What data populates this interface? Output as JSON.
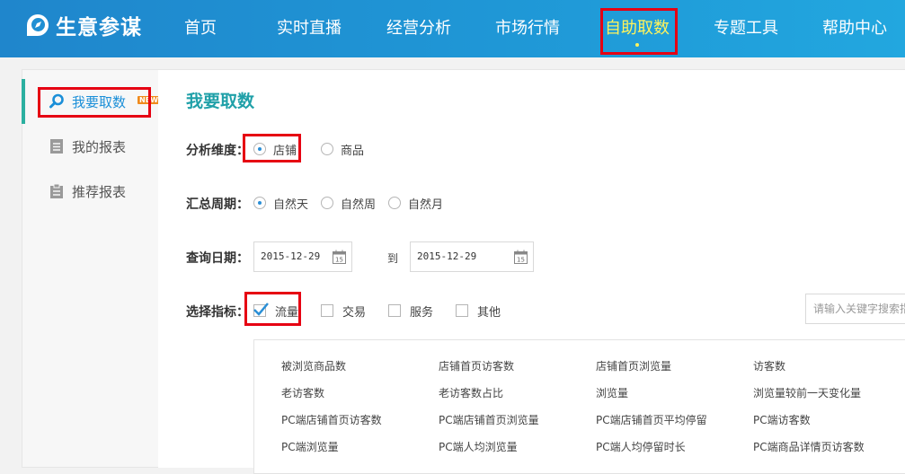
{
  "header": {
    "logo_text": "生意参谋",
    "nav": [
      {
        "label": "首页"
      },
      {
        "label": "实时直播"
      },
      {
        "label": "经营分析"
      },
      {
        "label": "市场行情"
      },
      {
        "label": "自助取数"
      },
      {
        "label": "专题工具"
      },
      {
        "label": "帮助中心"
      }
    ],
    "active_index": 4
  },
  "sidebar": {
    "items": [
      {
        "label": "我要取数",
        "icon": "search-icon",
        "badge": "NEW"
      },
      {
        "label": "我的报表",
        "icon": "report-icon"
      },
      {
        "label": "推荐报表",
        "icon": "clipboard-icon"
      }
    ]
  },
  "main": {
    "title": "我要取数",
    "dimension": {
      "label": "分析维度：",
      "options": [
        "店铺",
        "商品"
      ],
      "selected": "店铺"
    },
    "period": {
      "label": "汇总周期：",
      "options": [
        "自然天",
        "自然周",
        "自然月"
      ],
      "selected": "自然天"
    },
    "date": {
      "label": "查询日期：",
      "start": "2015-12-29",
      "to": "到",
      "end": "2015-12-29"
    },
    "metrics": {
      "label": "选择指标：",
      "categories": [
        "流量",
        "交易",
        "服务",
        "其他"
      ],
      "checked": [
        "流量"
      ],
      "search_placeholder": "请输入关键字搜索指",
      "items": [
        [
          "被浏览商品数",
          "店铺首页访客数",
          "店铺首页浏览量",
          "访客数"
        ],
        [
          "老访客数",
          "老访客数占比",
          "浏览量",
          "浏览量较前一天变化量"
        ],
        [
          "PC端店铺首页访客数",
          "PC端店铺首页浏览量",
          "PC端店铺首页平均停留",
          "PC端访客数"
        ],
        [
          "PC端浏览量",
          "PC端人均浏览量",
          "PC端人均停留时长",
          "PC端商品详情页访客数"
        ]
      ]
    }
  },
  "colors": {
    "header_blue": "#1f8fd3",
    "active_nav": "#fff35c",
    "highlight_red": "#e60012",
    "title_teal": "#1fa0a8",
    "link_blue": "#1b8fd8"
  }
}
